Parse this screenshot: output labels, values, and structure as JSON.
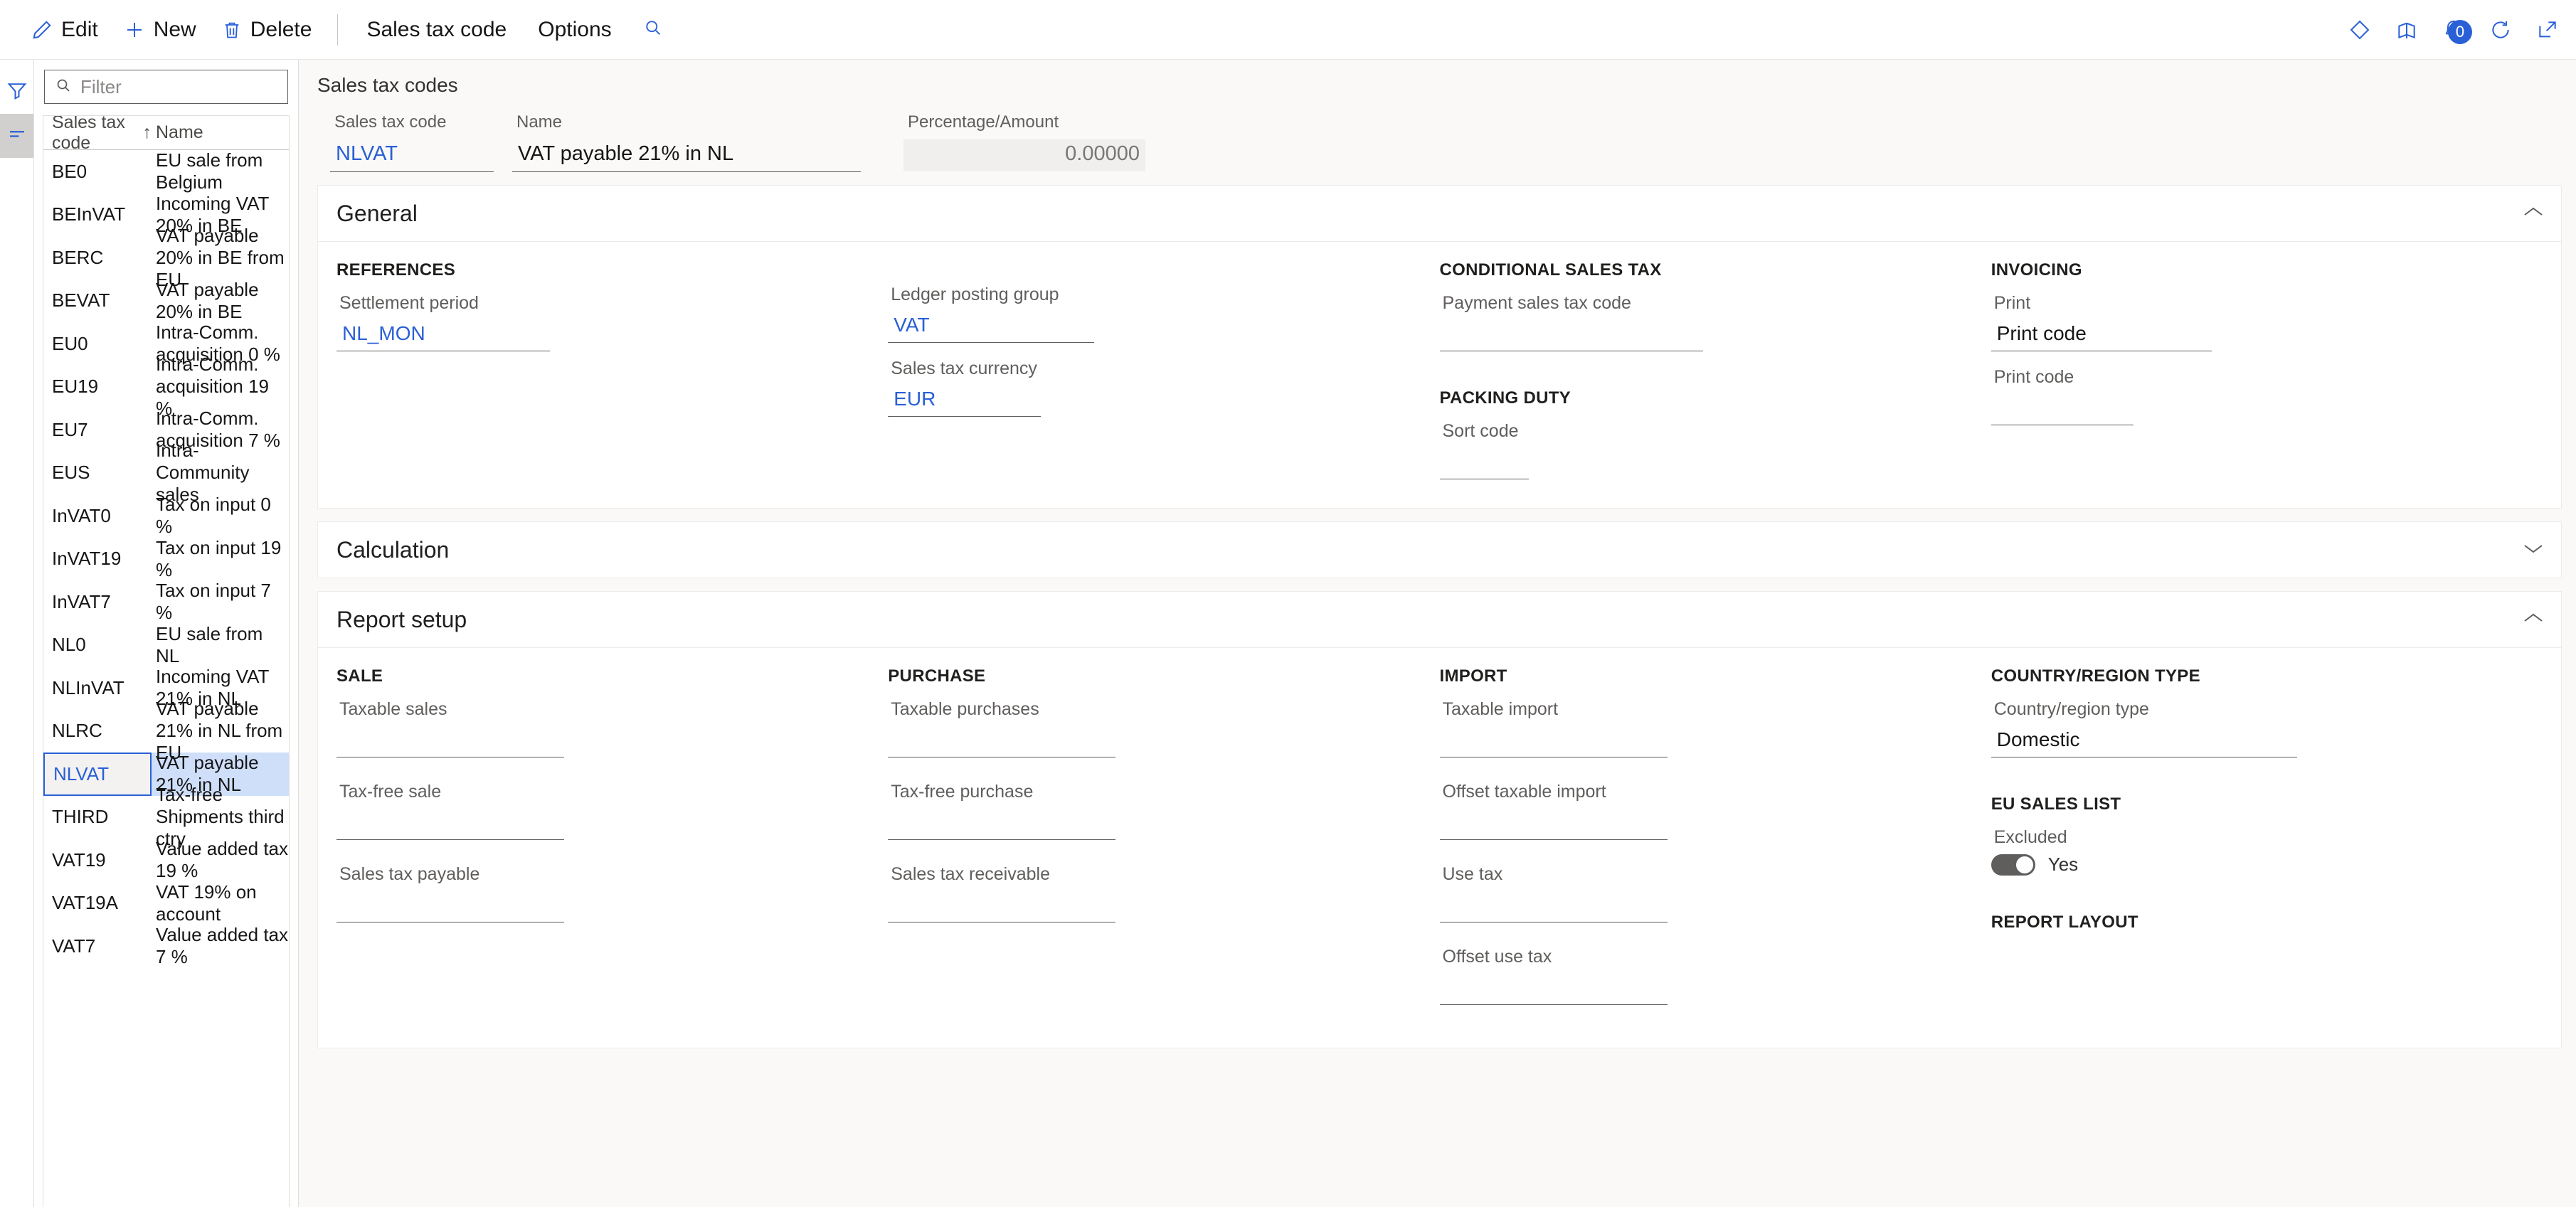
{
  "toolbar": {
    "edit_label": "Edit",
    "new_label": "New",
    "delete_label": "Delete",
    "sales_tax_code_menu": "Sales tax code",
    "options_menu": "Options",
    "notification_count": "0"
  },
  "list_pane": {
    "filter_placeholder": "Filter",
    "filter_value": "",
    "columns": [
      "Sales tax code",
      "Name"
    ],
    "sort_indicator": "↑",
    "rows": [
      {
        "code": "BE0",
        "name": "EU sale from Belgium",
        "selected": false
      },
      {
        "code": "BEInVAT",
        "name": "Incoming VAT 20% in BE",
        "selected": false
      },
      {
        "code": "BERC",
        "name": "VAT payable 20% in BE from EU",
        "selected": false
      },
      {
        "code": "BEVAT",
        "name": "VAT payable 20% in BE",
        "selected": false
      },
      {
        "code": "EU0",
        "name": "Intra-Comm. acquisition 0 %",
        "selected": false
      },
      {
        "code": "EU19",
        "name": "Intra-Comm. acquisition 19 %",
        "selected": false
      },
      {
        "code": "EU7",
        "name": "Intra-Comm. acquisition 7 %",
        "selected": false
      },
      {
        "code": "EUS",
        "name": "Intra-Community sales",
        "selected": false
      },
      {
        "code": "InVAT0",
        "name": "Tax on input 0 %",
        "selected": false
      },
      {
        "code": "InVAT19",
        "name": "Tax on input 19 %",
        "selected": false
      },
      {
        "code": "InVAT7",
        "name": "Tax on input 7 %",
        "selected": false
      },
      {
        "code": "NL0",
        "name": "EU sale from NL",
        "selected": false
      },
      {
        "code": "NLInVAT",
        "name": "Incoming VAT 21% in NL",
        "selected": false
      },
      {
        "code": "NLRC",
        "name": "VAT payable 21% in NL from EU",
        "selected": false
      },
      {
        "code": "NLVAT",
        "name": "VAT payable 21% in NL",
        "selected": true
      },
      {
        "code": "THIRD",
        "name": "Tax-free Shipments third ctry",
        "selected": false
      },
      {
        "code": "VAT19",
        "name": "Value added tax 19 %",
        "selected": false
      },
      {
        "code": "VAT19A",
        "name": "VAT 19% on account",
        "selected": false
      },
      {
        "code": "VAT7",
        "name": "Value added tax 7 %",
        "selected": false
      }
    ]
  },
  "detail": {
    "page_title": "Sales tax codes",
    "header_fields": {
      "code_label": "Sales tax code",
      "code_value": "NLVAT",
      "name_label": "Name",
      "name_value": "VAT payable 21% in NL",
      "percentage_label": "Percentage/Amount",
      "percentage_value": "0.00000"
    },
    "sections": {
      "general": {
        "title": "General",
        "expanded": true,
        "references": {
          "title": "REFERENCES",
          "settlement_period_label": "Settlement period",
          "settlement_period_value": "NL_MON"
        },
        "ledger": {
          "posting_group_label": "Ledger posting group",
          "posting_group_value": "VAT",
          "currency_label": "Sales tax currency",
          "currency_value": "EUR"
        },
        "conditional": {
          "title": "CONDITIONAL SALES TAX",
          "payment_code_label": "Payment sales tax code",
          "payment_code_value": ""
        },
        "packing_duty": {
          "title": "PACKING DUTY",
          "sort_code_label": "Sort code",
          "sort_code_value": ""
        },
        "invoicing": {
          "title": "INVOICING",
          "print_label": "Print",
          "print_value": "Print code",
          "print_code_label": "Print code",
          "print_code_value": ""
        }
      },
      "calculation": {
        "title": "Calculation",
        "expanded": false
      },
      "report_setup": {
        "title": "Report setup",
        "expanded": true,
        "sale": {
          "title": "SALE",
          "fields": [
            {
              "label": "Taxable sales",
              "value": ""
            },
            {
              "label": "Tax-free sale",
              "value": ""
            },
            {
              "label": "Sales tax payable",
              "value": ""
            }
          ]
        },
        "purchase": {
          "title": "PURCHASE",
          "fields": [
            {
              "label": "Taxable purchases",
              "value": ""
            },
            {
              "label": "Tax-free purchase",
              "value": ""
            },
            {
              "label": "Sales tax receivable",
              "value": ""
            }
          ]
        },
        "import": {
          "title": "IMPORT",
          "fields": [
            {
              "label": "Taxable import",
              "value": ""
            },
            {
              "label": "Offset taxable import",
              "value": ""
            },
            {
              "label": "Use tax",
              "value": ""
            },
            {
              "label": "Offset use tax",
              "value": ""
            }
          ]
        },
        "country_region": {
          "title": "COUNTRY/REGION TYPE",
          "type_label": "Country/region type",
          "type_value": "Domestic"
        },
        "eu_sales_list": {
          "title": "EU SALES LIST",
          "excluded_label": "Excluded",
          "toggle_value": "Yes"
        },
        "report_layout": {
          "title": "REPORT LAYOUT"
        }
      }
    }
  }
}
